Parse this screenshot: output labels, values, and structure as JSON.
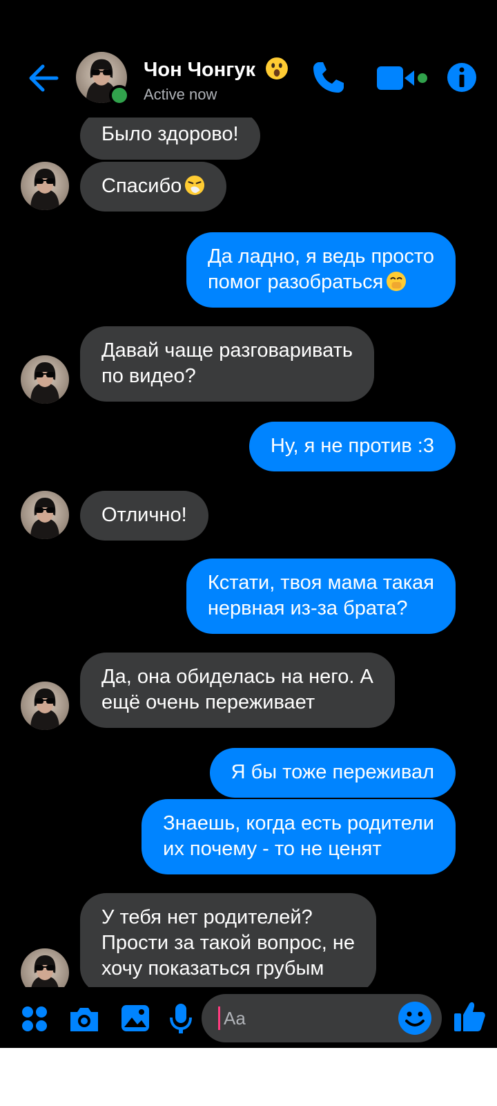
{
  "header": {
    "contact_name": "Чон Чонгук",
    "status": "Active now"
  },
  "messages": [
    {
      "side": "in",
      "lines": [
        "Было здорово!"
      ]
    },
    {
      "side": "in",
      "lines": [
        "Спасибо"
      ],
      "emoji": "sneezing-face"
    },
    {
      "side": "out",
      "lines": [
        "Да ладно, я ведь просто",
        "помог разобраться"
      ],
      "emoji": "hand-over-mouth-face"
    },
    {
      "side": "in",
      "lines": [
        "Давай чаще разговаривать",
        "по видео?"
      ]
    },
    {
      "side": "out",
      "lines": [
        "Ну, я не против :3"
      ]
    },
    {
      "side": "in",
      "lines": [
        "Отлично!"
      ]
    },
    {
      "side": "out",
      "lines": [
        "Кстати, твоя мама такая",
        "нервная из-за брата?"
      ]
    },
    {
      "side": "in",
      "lines": [
        "Да, она обиделась на него. А",
        "ещё очень переживает"
      ]
    },
    {
      "side": "out",
      "lines": [
        "Я бы тоже переживал"
      ]
    },
    {
      "side": "out",
      "lines": [
        "Знаешь, когда есть родители",
        "их почему - то не ценят"
      ]
    },
    {
      "side": "in",
      "lines": [
        "У тебя нет родителей?",
        "Прости за такой вопрос, не",
        "хочу показаться грубым"
      ]
    }
  ],
  "composer": {
    "placeholder": "Aa"
  },
  "colors": {
    "background": "#000000",
    "accent": "#0084ff",
    "incoming_bubble": "#3a3b3c",
    "online": "#31a24c"
  },
  "icons": [
    "back-arrow-icon",
    "surprised-face-icon",
    "phone-icon",
    "video-camera-icon",
    "info-icon",
    "apps-icon",
    "camera-icon",
    "gallery-icon",
    "microphone-icon",
    "smiley-icon",
    "thumbs-up-icon"
  ]
}
